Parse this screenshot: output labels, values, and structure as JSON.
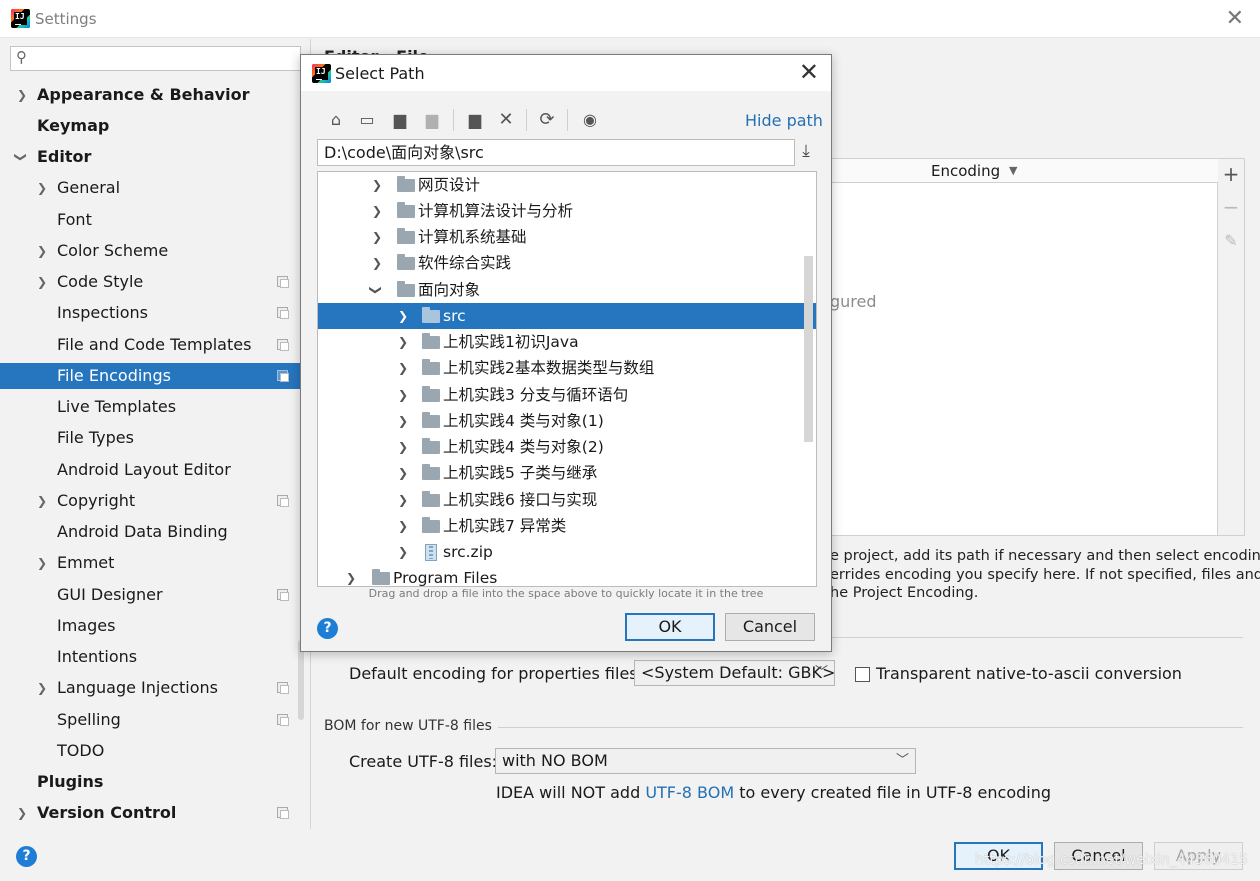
{
  "window": {
    "title": "Settings",
    "app_icon": "IJ"
  },
  "sidebar": {
    "search_placeholder": "",
    "items": [
      {
        "label": "Appearance & Behavior"
      },
      {
        "label": "Keymap"
      },
      {
        "label": "Editor"
      },
      {
        "label": "General"
      },
      {
        "label": "Font"
      },
      {
        "label": "Color Scheme"
      },
      {
        "label": "Code Style"
      },
      {
        "label": "Inspections"
      },
      {
        "label": "File and Code Templates"
      },
      {
        "label": "File Encodings"
      },
      {
        "label": "Live Templates"
      },
      {
        "label": "File Types"
      },
      {
        "label": "Android Layout Editor"
      },
      {
        "label": "Copyright"
      },
      {
        "label": "Android Data Binding"
      },
      {
        "label": "Emmet"
      },
      {
        "label": "GUI Designer"
      },
      {
        "label": "Images"
      },
      {
        "label": "Intentions"
      },
      {
        "label": "Language Injections"
      },
      {
        "label": "Spelling"
      },
      {
        "label": "TODO"
      },
      {
        "label": "Plugins"
      },
      {
        "label": "Version Control"
      }
    ]
  },
  "content": {
    "page_title": "Editor › File Encodings",
    "table": {
      "encoding_header": "Encoding",
      "empty_text": "gured"
    },
    "description_lines": [
      "e project, add its path if necessary and then select encoding",
      "errides encoding you specify here. If not specified, files and",
      "he Project Encoding."
    ],
    "properties": {
      "label": "Default encoding for properties files:",
      "value": "<System Default: GBK>",
      "transparent_label": "Transparent native-to-ascii conversion"
    },
    "bom": {
      "group_title": "BOM for new UTF-8 files",
      "create_label": "Create UTF-8 files:",
      "create_value": "with NO BOM",
      "note_prefix": "IDEA will NOT add ",
      "note_link": "UTF-8 BOM",
      "note_suffix": " to every created file in UTF-8 encoding"
    }
  },
  "footer": {
    "ok": "OK",
    "cancel": "Cancel",
    "apply": "Apply",
    "watermark": "https://blog.csdn.net/weixin_44360415"
  },
  "dialog": {
    "title": "Select Path",
    "hide_path": "Hide path",
    "path_value": "D:\\code\\面向对象\\src",
    "tree": [
      {
        "label": "网页设计"
      },
      {
        "label": "计算机算法设计与分析"
      },
      {
        "label": "计算机系统基础"
      },
      {
        "label": "软件综合实践"
      },
      {
        "label": "面向对象"
      },
      {
        "label": "src"
      },
      {
        "label": "上机实践1初识Java"
      },
      {
        "label": "上机实践2基本数据类型与数组"
      },
      {
        "label": "上机实践3 分支与循环语句"
      },
      {
        "label": "上机实践4 类与对象(1)"
      },
      {
        "label": "上机实践4 类与对象(2)"
      },
      {
        "label": "上机实践5 子类与继承"
      },
      {
        "label": "上机实践6 接口与实现"
      },
      {
        "label": "上机实践7 异常类"
      },
      {
        "label": "src.zip"
      },
      {
        "label": "Program Files"
      }
    ],
    "hint": "Drag and drop a file into the space above to quickly locate it in the tree",
    "ok": "OK",
    "cancel": "Cancel"
  }
}
